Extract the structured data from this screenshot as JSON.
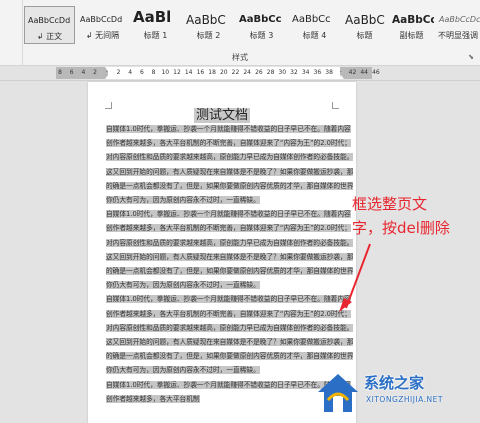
{
  "styles_gallery": {
    "items": [
      {
        "preview": "AaBbCcDd",
        "label": "正文",
        "selected": true
      },
      {
        "preview": "AaBbCcDd",
        "label": "无间隔",
        "selected": false
      },
      {
        "preview": "AaBl",
        "label": "标题 1",
        "selected": false
      },
      {
        "preview": "AaBbC",
        "label": "标题 2",
        "selected": false
      },
      {
        "preview": "AaBbCc",
        "label": "标题 3",
        "selected": false
      },
      {
        "preview": "AaBbCc",
        "label": "标题 4",
        "selected": false
      },
      {
        "preview": "AaBbC",
        "label": "标题",
        "selected": false
      },
      {
        "preview": "AaBbCc",
        "label": "副标题",
        "selected": false
      },
      {
        "preview": "AaBbCcDc",
        "label": "不明显强调",
        "selected": false
      }
    ],
    "group_label": "样式"
  },
  "ruler": {
    "ticks": [
      "8",
      "6",
      "4",
      "2",
      "",
      "2",
      "4",
      "6",
      "8",
      "10",
      "12",
      "14",
      "16",
      "18",
      "20",
      "22",
      "24",
      "26",
      "28",
      "30",
      "32",
      "34",
      "36",
      "38",
      "",
      "42",
      "44",
      "46"
    ]
  },
  "document": {
    "title": "测试文档",
    "paragraphs": [
      "自媒体1.0时代，拳搬运、抄袭一个月就能赚得不错收益的日子早已不在。随着内容创作者越来越多，各大平台机制的不断完善，自媒体迎来了“内容为王”的2.0时代；对内容原创性和品质的要求越来越高，原创能力早已成为自媒体创作者的必备技能。这又回到开始的问题，有人质疑现在来自媒体是不是晚了？如果你要做搬运抄袭，那的确是一点机会都没有了，但是，如果你要做原创内容优质的才华，那自媒体的世界你仍大有可为，因为原创内容永不过时，一直稀缺。",
      "自媒体1.0时代，拳搬运、抄袭一个月就能赚得不错收益的日子早已不在。随着内容创作者越来越多，各大平台机制的不断完善，自媒体迎来了“内容为王”的2.0时代；对内容原创性和品质的要求越来越高，原创能力早已成为自媒体创作者的必备技能。这又回到开始的问题，有人质疑现在来自媒体是不是晚了？如果你要做搬运抄袭，那的确是一点机会都没有了，但是，如果你要做原创内容优质的才华，那自媒体的世界你仍大有可为，因为原创内容永不过时，一直稀缺。",
      "自媒体1.0时代，拳搬运、抄袭一个月就能赚得不错收益的日子早已不在。随着内容创作者越来越多，各大平台机制的不断完善，自媒体迎来了“内容为王”的2.0时代；对内容原创性和品质的要求越来越高，原创能力早已成为自媒体创作者的必备技能。这又回到开始的问题，有人质疑现在来自媒体是不是晚了？如果你要做搬运抄袭，那的确是一点机会都没有了，但是，如果你要做原创内容优质的才华，那自媒体的世界你仍大有可为，因为原创内容永不过时，一直稀缺。",
      "自媒体1.0时代，拳搬运、抄袭一个月就能赚得不错收益的日子早已不在。随着内容创作者越来越多，各大平台机制"
    ]
  },
  "annotation": {
    "line1": "框选整页文",
    "line2": "字，按del删除",
    "color": "#e8262f"
  },
  "watermark": {
    "name": "系统之家",
    "url": "XITONGZHIJIA.NET"
  }
}
